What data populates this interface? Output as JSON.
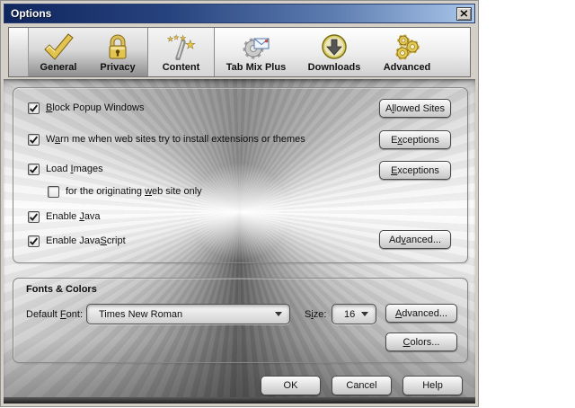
{
  "window": {
    "title": "Options"
  },
  "icons": {
    "close": "close-icon",
    "general": "checkmark-icon",
    "privacy": "padlock-icon",
    "content": "magic-wand-icon",
    "tab_mix_plus": "gear-envelope-icon",
    "downloads": "download-arrow-icon",
    "advanced": "gears-icon"
  },
  "toolbar": {
    "tabs": [
      {
        "label": "General",
        "selected": false
      },
      {
        "label": "Privacy",
        "selected": false
      },
      {
        "label": "Content",
        "selected": true
      },
      {
        "label": "Tab Mix Plus",
        "selected": false
      },
      {
        "label": "Downloads",
        "selected": false
      },
      {
        "label": "Advanced",
        "selected": false
      }
    ]
  },
  "content_panel": {
    "rows": [
      {
        "pre": "",
        "key": "B",
        "post": "lock Popup Windows",
        "checked": true,
        "indent": false
      },
      {
        "pre": "W",
        "key": "a",
        "post": "rn me when web sites try to install extensions or themes",
        "checked": true,
        "indent": false
      },
      {
        "pre": "Load ",
        "key": "I",
        "post": "mages",
        "checked": true,
        "indent": false
      },
      {
        "pre": "for the originating ",
        "key": "w",
        "post": "eb site only",
        "checked": false,
        "indent": true
      },
      {
        "pre": "Enable ",
        "key": "J",
        "post": "ava",
        "checked": true,
        "indent": false
      },
      {
        "pre": "Enable Java",
        "key": "S",
        "post": "cript",
        "checked": true,
        "indent": false
      }
    ],
    "buttons": [
      {
        "pre": "A",
        "key": "l",
        "post": "lowed Sites"
      },
      {
        "pre": "E",
        "key": "x",
        "post": "ceptions"
      },
      {
        "pre": "",
        "key": "E",
        "post": "xceptions"
      },
      {
        "pre": "Ad",
        "key": "v",
        "post": "anced..."
      }
    ]
  },
  "fonts_colors": {
    "title": "Fonts & Colors",
    "default_font_label": {
      "pre": "Default ",
      "key": "F",
      "post": "ont:"
    },
    "font_value": "Times New Roman",
    "size_label": {
      "pre": "S",
      "key": "i",
      "post": "ze:"
    },
    "size_value": "16",
    "advanced_button": {
      "pre": "",
      "key": "A",
      "post": "dvanced..."
    },
    "colors_button": {
      "pre": "",
      "key": "C",
      "post": "olors..."
    }
  },
  "footer": {
    "ok": "OK",
    "cancel": "Cancel",
    "help": "Help"
  },
  "colors": {
    "titlebar_left": "#10265e",
    "titlebar_right": "#a9c6ea",
    "gold_accent": "#e2c44e",
    "frame_gray": "#d4d0c8"
  }
}
